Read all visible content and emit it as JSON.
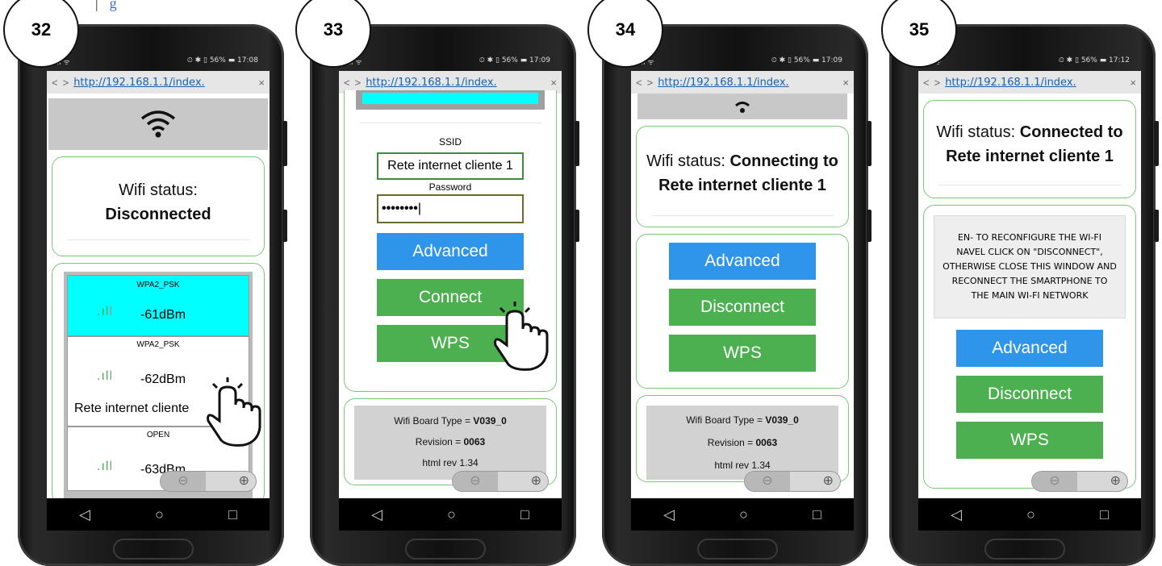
{
  "header_fragment": "g",
  "statusbars": [
    {
      "left": "ıll ᯤ",
      "right": "⏲ ✱ ▯ 56% ▬ 17:08"
    },
    {
      "left": "ıll ᯤ",
      "right": "⏲ ✱ ▯ 56% ▬ 17:09"
    },
    {
      "left": "ıll ᯤ",
      "right": "⏲ ✱ ▯ 56% ▬ 17:09"
    },
    {
      "left": "ıll ᯤ",
      "right": "⏲ ✱ ▯ 56% ▬ 17:12"
    }
  ],
  "step_numbers": [
    "32",
    "33",
    "34",
    "35"
  ],
  "browser": {
    "url": "http://192.168.1.1/index.",
    "back": "<",
    "forward": ">",
    "close": "×"
  },
  "nav": {
    "back": "◁",
    "home": "○",
    "recent": "□"
  },
  "phone1": {
    "status_label": "Wifi status:",
    "status_value": "Disconnected",
    "networks": [
      {
        "security": "WPA2_PSK",
        "signal": "-61dBm",
        "ssid": "",
        "selected": true
      },
      {
        "security": "WPA2_PSK",
        "signal": "-62dBm",
        "ssid": "Rete internet cliente",
        "selected": false
      },
      {
        "security": "OPEN",
        "signal": "-63dBm",
        "ssid": "",
        "selected": false
      }
    ]
  },
  "phone2": {
    "ssid_label": "SSID",
    "ssid_value": "Rete internet cliente 1",
    "password_label": "Password",
    "password_value": "••••••••",
    "advanced": "Advanced",
    "connect": "Connect",
    "wps": "WPS",
    "board_type_label": "Wifi Board Type = ",
    "board_type_value": "V039_0",
    "revision_label": "Revision = ",
    "revision_value": "0063",
    "html_rev": "html rev 1.34"
  },
  "phone3": {
    "status_label": "Wifi status: ",
    "status_value": "Connecting to Rete internet cliente 1",
    "advanced": "Advanced",
    "disconnect": "Disconnect",
    "wps": "WPS",
    "board_type_label": "Wifi Board Type = ",
    "board_type_value": "V039_0",
    "revision_label": "Revision = ",
    "revision_value": "0063",
    "html_rev": "html rev 1.34"
  },
  "phone4": {
    "status_label": "Wifi status: ",
    "status_value": "Connected to Rete internet cliente 1",
    "instructions": "EN- TO RECONFIGURE THE WI-FI NAVEL CLICK ON \"DISCONNECT\", OTHERWISE CLOSE THIS WINDOW AND RECONNECT THE SMARTPHONE TO THE MAIN WI-FI NETWORK",
    "advanced": "Advanced",
    "disconnect": "Disconnect",
    "wps": "WPS"
  },
  "zoom": {
    "minus": "⊖",
    "plus": "⊕"
  },
  "colors": {
    "accent_blue": "#2f95ea",
    "accent_green": "#4caf50",
    "selected_network": "#00ffff",
    "card_border": "#7cc97c"
  }
}
